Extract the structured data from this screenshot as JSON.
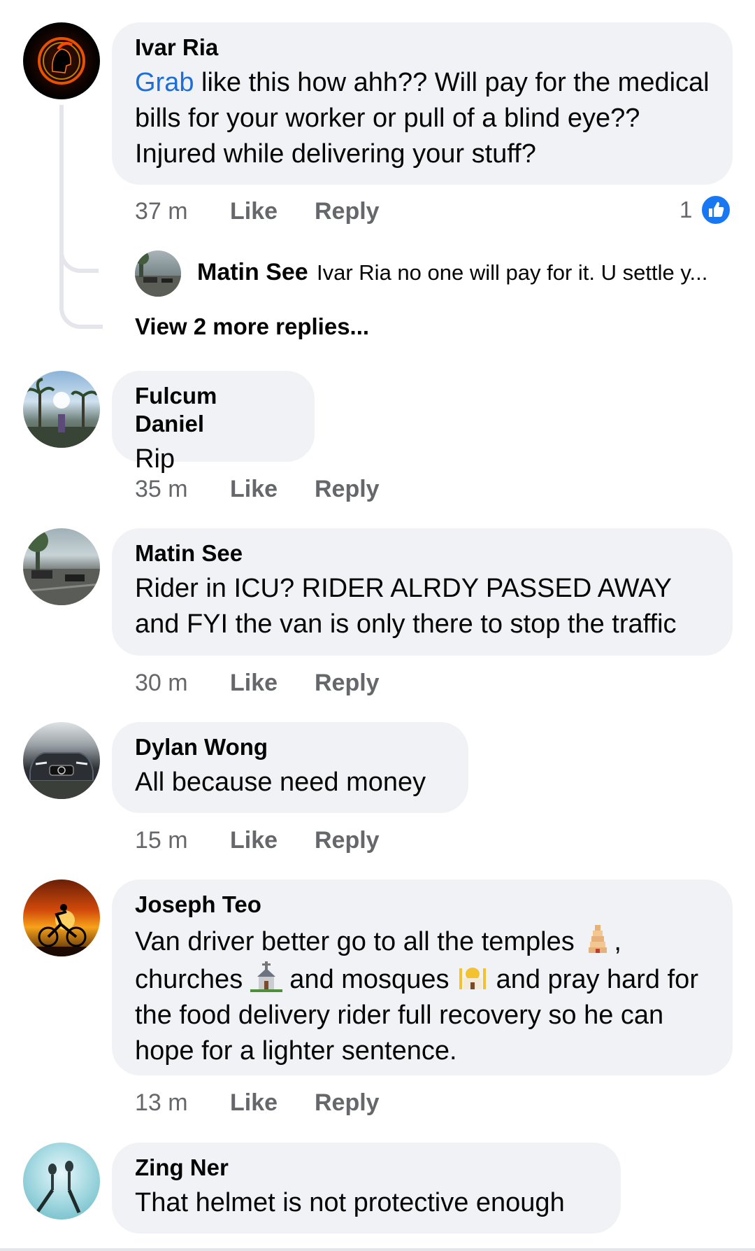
{
  "comments": [
    {
      "author": "Ivar Ria",
      "mention": "Grab",
      "text": " like this how ahh?? Will pay for the medical bills for your worker or pull of a blind eye?? Injured while delivering your stuff?",
      "time": "37 m",
      "like": "Like",
      "reply": "Reply",
      "reaction_count": "1",
      "reaction_icon": "thumbs-up-icon",
      "nested_reply": {
        "author": "Matin See",
        "text": "Ivar Ria no one will pay for it. U settle y..."
      },
      "view_more": "View 2 more replies..."
    },
    {
      "author": "Fulcum Daniel",
      "text": "Rip",
      "time": "35 m",
      "like": "Like",
      "reply": "Reply"
    },
    {
      "author": "Matin See",
      "text": "Rider in ICU? RIDER ALRDY PASSED AWAY and FYI the van is only there to stop the traffic",
      "time": "30 m",
      "like": "Like",
      "reply": "Reply"
    },
    {
      "author": "Dylan Wong",
      "text": "All because need money",
      "time": "15 m",
      "like": "Like",
      "reply": "Reply"
    },
    {
      "author": "Joseph Teo",
      "text_parts": [
        "Van driver better go to all the temples ",
        ",",
        "churches ",
        " and mosques ",
        " and pray hard for the food delivery rider full recovery so he can hope for a lighter sentence."
      ],
      "emojis": [
        "temple-icon",
        "church-icon",
        "mosque-icon"
      ],
      "time": "13 m",
      "like": "Like",
      "reply": "Reply"
    },
    {
      "author": "Zing Ner",
      "text": "That helmet is not protective enough"
    }
  ],
  "colors": {
    "bubble": "#f0f2f5",
    "meta": "#65676b",
    "mention": "#1d6ed8",
    "like_blue": "#1877f2"
  }
}
